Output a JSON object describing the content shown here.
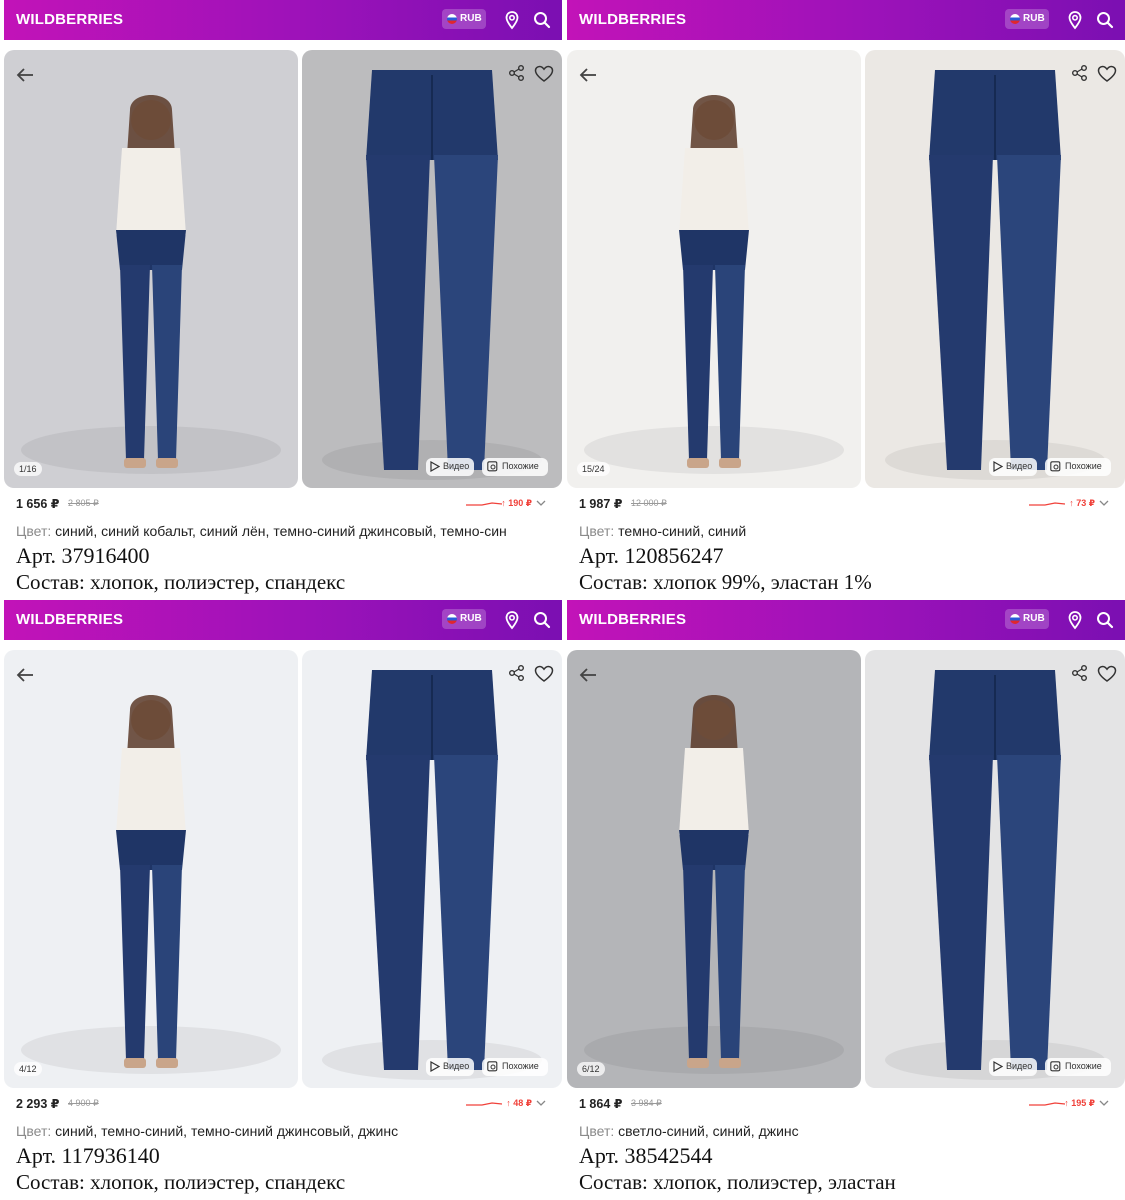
{
  "header": {
    "logo": "WILDBERRIES",
    "currency": "RUB"
  },
  "photo_buttons": {
    "video": "Видео",
    "similar": "Похожие"
  },
  "icons": [
    "back-arrow-icon",
    "share-icon",
    "heart-icon",
    "location-pin-icon",
    "search-icon",
    "play-icon",
    "similar-search-icon"
  ],
  "colors": {
    "brand_left": "#c213b8",
    "brand_right": "#7b0fb2",
    "price_up": "#f0413a",
    "denim": "#243a6e"
  },
  "products": [
    {
      "counter": "1/16",
      "price": "1 656 ₽",
      "old_price": "2 805 ₽",
      "delta": "↑ 190 ₽",
      "color_label": "Цвет:",
      "color_value": "синий, синий кобальт, синий лён, темно-синий джинсовый, темно-син",
      "article": "Арт. 37916400",
      "composition": "Состав: хлопок, полиэстер, спандекс",
      "photo_a_bg": "#cfcfd3",
      "photo_b_bg": "#bcbcbe"
    },
    {
      "counter": "15/24",
      "price": "1 987 ₽",
      "old_price": "12 000 ₽",
      "delta": "↑ 73 ₽",
      "color_label": "Цвет:",
      "color_value": "темно-синий, синий",
      "article": "Арт. 120856247",
      "composition": "Состав: хлопок 99%, эластан 1%",
      "photo_a_bg": "#f1f0ee",
      "photo_b_bg": "#ebe8e4"
    },
    {
      "counter": "4/12",
      "price": "2 293 ₽",
      "old_price": "4 900 ₽",
      "delta": "↑ 48 ₽",
      "color_label": "Цвет:",
      "color_value": "синий, темно-синий, темно-синий джинсовый, джинс",
      "article": "Арт. 117936140",
      "composition": "Состав: хлопок, полиэстер, спандекс",
      "photo_a_bg": "#eef0f3",
      "photo_b_bg": "#eef0f3"
    },
    {
      "counter": "6/12",
      "price": "1 864 ₽",
      "old_price": "3 984 ₽",
      "delta": "↑ 195 ₽",
      "color_label": "Цвет:",
      "color_value": "светло-синий, синий, джинс",
      "article": "Арт. 38542544",
      "composition": "Состав: хлопок, полиэстер, эластан",
      "photo_a_bg": "#b4b5b8",
      "photo_b_bg": "#e4e4e5"
    }
  ]
}
